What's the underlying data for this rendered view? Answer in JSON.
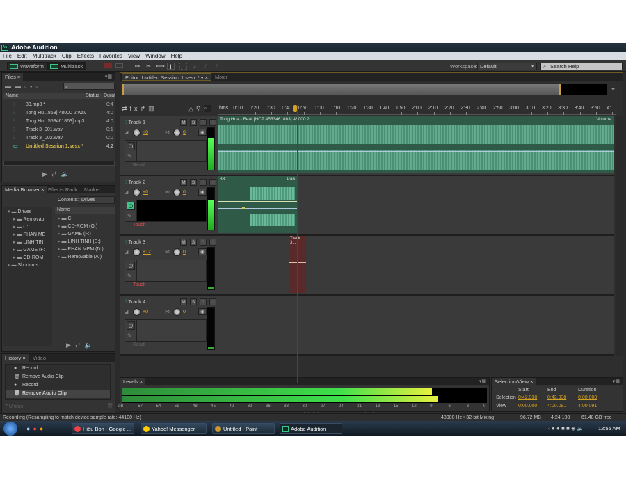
{
  "window": {
    "title": "Adobe Audition",
    "app_icon": "Au"
  },
  "menu": [
    "File",
    "Edit",
    "Multitrack",
    "Clip",
    "Effects",
    "Favorites",
    "View",
    "Window",
    "Help"
  ],
  "toolbar": {
    "waveform_label": "Waveform",
    "multitrack_label": "Multitrack",
    "tools": [
      "move-tool-icon",
      "razor-tool-icon",
      "slip-tool-icon",
      "time-selection-tool-icon",
      "marquee-tool-icon",
      "lasso-tool-icon",
      "brush-tool-icon"
    ],
    "workspace_label": "Workspace:",
    "workspace_value": "Default",
    "search_placeholder": "Search Help"
  },
  "files_panel": {
    "tab": "Files",
    "columns": [
      "Name",
      "Status",
      "Durat"
    ],
    "items": [
      {
        "name": "33.mp3 *",
        "duration": "0:4",
        "type": "audio"
      },
      {
        "name": "Tong Hu...863] 48000 2.wav",
        "duration": "4:0",
        "type": "audio"
      },
      {
        "name": "Tong Hu...553461863].mp3",
        "duration": "4:0",
        "type": "audio"
      },
      {
        "name": "Track 3_001.wav",
        "duration": "0:1",
        "type": "audio"
      },
      {
        "name": "Track 3_002.wav",
        "duration": "0:0",
        "type": "audio"
      },
      {
        "name": "Untitled Session 1.sesx *",
        "duration": "4:2",
        "type": "session"
      }
    ]
  },
  "media_browser": {
    "tabs": [
      "Media Browser",
      "Effects Rack",
      "Marker"
    ],
    "contents_label": "Contents:",
    "contents_value": "Drives",
    "tree": [
      "Drives",
      "Removab",
      "C:",
      "PHAN ME",
      "LINH TIN",
      "GAME (F:",
      "CD-ROM",
      "Shortcuts"
    ],
    "list_header": "Name",
    "list": [
      "C:",
      "CD-ROM (G:)",
      "GAME (F:)",
      "LINH TINH (E:)",
      "PHAN MEM (D:)",
      "Removable (A:)"
    ]
  },
  "history": {
    "tabs": [
      "History",
      "Video"
    ],
    "items": [
      "Record",
      "Remove Audio Clip",
      "Record",
      "Remove Audio Clip"
    ],
    "undos": "7 Undos"
  },
  "editor": {
    "tab": "Editor: Untitled Session 1.sesx *",
    "mixer_tab": "Mixer",
    "ruler_unit": "hms",
    "ruler": [
      "0:10",
      "0:20",
      "0:30",
      "0:40",
      "0:50",
      "1:00",
      "1:10",
      "1:20",
      "1:30",
      "1:40",
      "1:50",
      "2:00",
      "2:10",
      "2:20",
      "2:30",
      "2:40",
      "2:50",
      "3:00",
      "3:10",
      "3:20",
      "3:30",
      "3:40",
      "3:50",
      "4:"
    ],
    "playhead_time": "0:46.758",
    "tracks": [
      {
        "name": "Track 1",
        "volume": "+0",
        "pan": "0",
        "mode": "Read",
        "clip": "Tong Hua - Beat [NCT 4553461863] 48000 2",
        "lane_param": "Volume"
      },
      {
        "name": "Track 2",
        "volume": "+0",
        "pan": "0",
        "mode": "Touch",
        "clip": "33",
        "lane_param": "Pan"
      },
      {
        "name": "Track 3",
        "volume": "+12",
        "pan": "0",
        "mode": "Touch",
        "clip": "Track 3..."
      },
      {
        "name": "Track 4",
        "volume": "+0",
        "pan": "0",
        "mode": "Read"
      }
    ],
    "track_buttons": [
      "M",
      "S",
      "R",
      "I"
    ]
  },
  "levels": {
    "tab": "Levels",
    "scale": [
      "dB",
      "-57",
      "-54",
      "-51",
      "-48",
      "-45",
      "-42",
      "-39",
      "-36",
      "-33",
      "-30",
      "-27",
      "-24",
      "-21",
      "-18",
      "-15",
      "-12",
      "-9",
      "-6",
      "-3",
      "0"
    ],
    "left_db": -9,
    "right_db": -8
  },
  "selection_view": {
    "tab": "Selection/View",
    "headers": [
      "Start",
      "End",
      "Duration"
    ],
    "rows": [
      {
        "label": "Selection",
        "start": "0:42.938",
        "end": "0:42.938",
        "duration": "0:00.000"
      },
      {
        "label": "View",
        "start": "0:00.000",
        "end": "4:00.091",
        "duration": "4:00.091"
      }
    ]
  },
  "status": {
    "message": "Recording (Resampling to match device sample rate: 44100 Hz)",
    "format": "48000 Hz • 32-bit Mixing",
    "memory": "96.72 MB",
    "duration": "4:24.100",
    "disk": "61.48 GB free"
  },
  "taskbar": {
    "tasks": [
      "Hiếu Bon - Google ...",
      "Yahoo! Messenger",
      "Untitled - Paint",
      "Adobe Audition"
    ],
    "clock": "12:55 AM"
  }
}
